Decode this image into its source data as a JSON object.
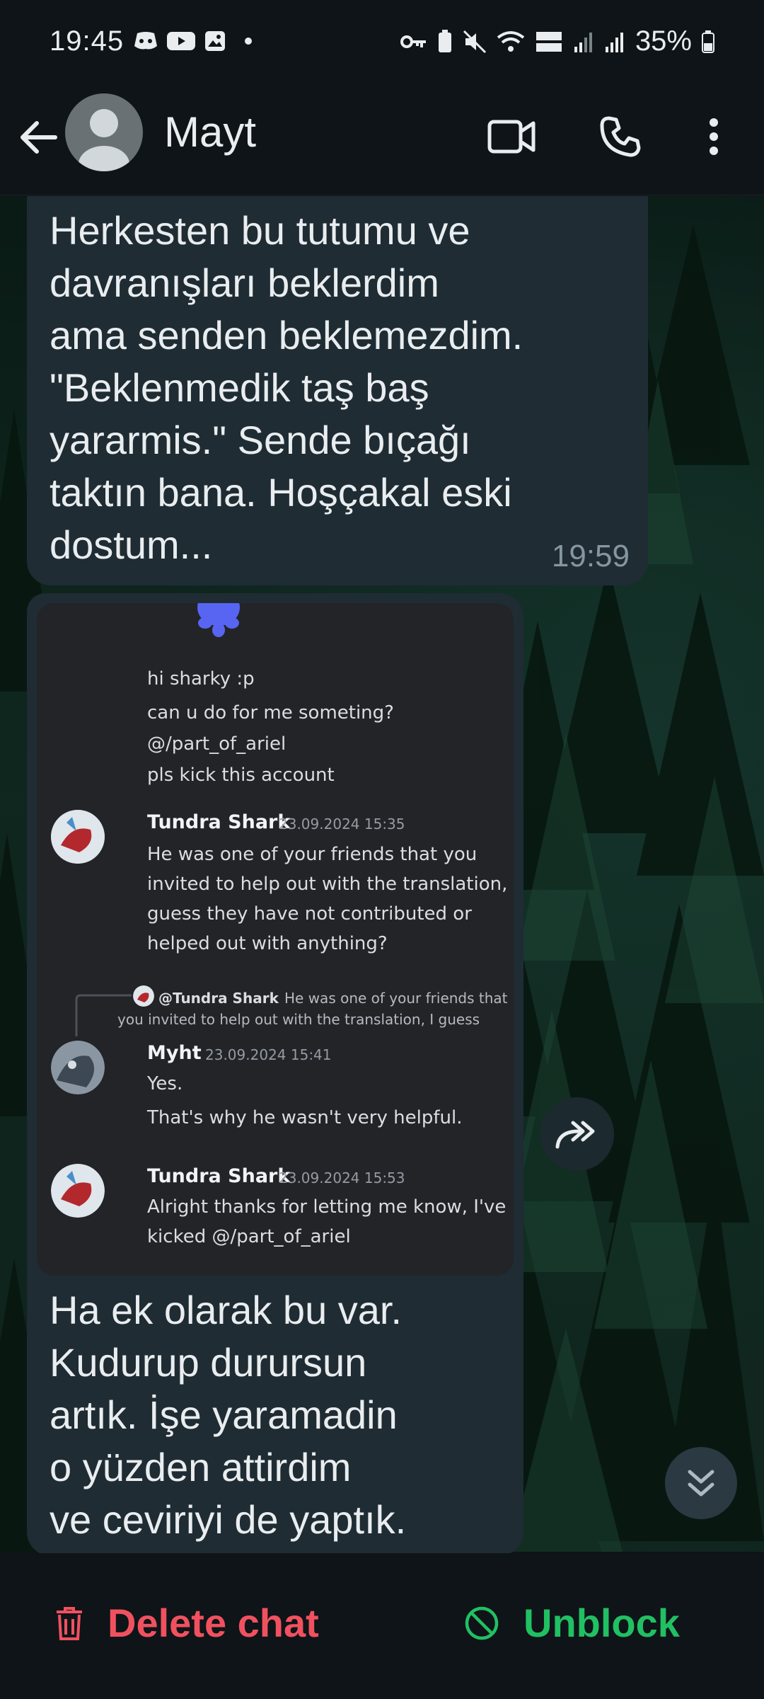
{
  "status_bar": {
    "time": "19:45",
    "battery": "35%"
  },
  "header": {
    "contact_name": "Mayt"
  },
  "messages": [
    {
      "text": "Herkesten bu tutumu ve\ndavranışları beklerdim\nama senden beklemezdim.\n\"Beklenmedik taş baş\nyararmis.\" Sende bıçağı\ntaktın bana. Hoşçakal eski\ndostum...",
      "time": "19:59"
    },
    {
      "caption": "Ha ek olarak bu var.\nKudurup durursun\nartık. İşe yaramadin\no yüzden attirdim\nve ceviriyi de yaptık."
    }
  ],
  "screenshot": {
    "lines": [
      "hi sharky :p",
      "can u do for me someting?",
      "@/part_of_ariel",
      "pls kick this account"
    ],
    "posts": [
      {
        "author": "Tundra Shark",
        "timestamp": "23.09.2024 15:35",
        "lines": [
          "He was one of your friends that you",
          "invited to help out with the translation, I",
          "guess they have not contributed or",
          "helped out with anything?"
        ]
      },
      {
        "reply_author": "@Tundra Shark",
        "reply_line1": "He was one of your friends that",
        "reply_line2": "you invited to help out with the translation, I guess",
        "author": "Myht",
        "timestamp": "23.09.2024 15:41",
        "lines": [
          "Yes.",
          "That's why he wasn't very helpful."
        ]
      },
      {
        "author": "Tundra Shark",
        "timestamp": "23.09.2024 15:53",
        "lines": [
          "Alright thanks for letting me know, I've",
          "kicked @/part_of_ariel"
        ]
      }
    ]
  },
  "bottom_actions": {
    "delete": "Delete chat",
    "unblock": "Unblock"
  },
  "colors": {
    "delete": "#f1515f",
    "unblock": "#21c063",
    "bubble": "#1f2c33"
  },
  "icons": [
    "back-arrow-icon",
    "avatar-icon",
    "video-call-icon",
    "phone-icon",
    "more-vert-icon",
    "forward-icon",
    "scroll-down-icon",
    "trash-icon",
    "block-icon"
  ]
}
